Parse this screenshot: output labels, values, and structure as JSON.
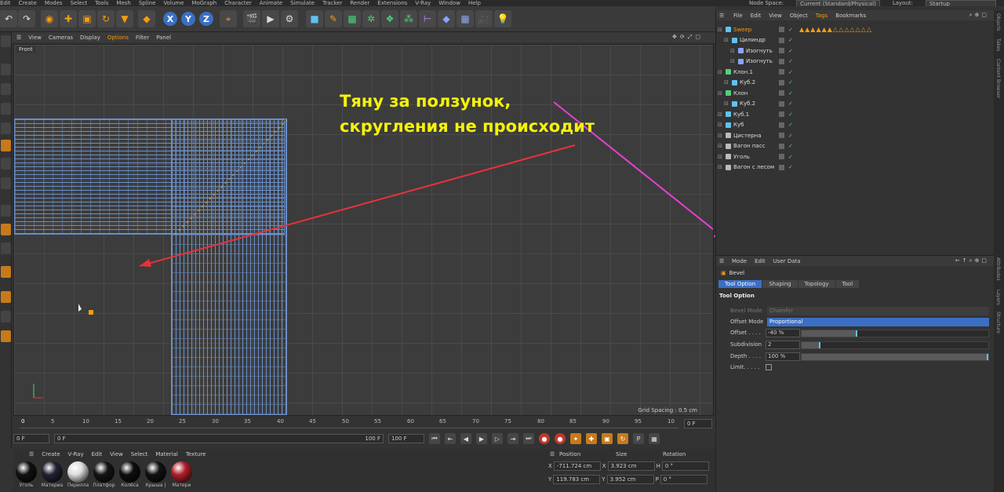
{
  "menubar": {
    "items": [
      "Edit",
      "Create",
      "Modes",
      "Select",
      "Tools",
      "Mesh",
      "Spline",
      "Volume",
      "MoGraph",
      "Character",
      "Animate",
      "Simulate",
      "Tracker",
      "Render",
      "Extensions",
      "V-Ray",
      "Window",
      "Help"
    ],
    "node_space_label": "Node Space:",
    "node_space_value": "Current (Standard/Physical)",
    "layout_label": "Layout:",
    "layout_value": "Startup"
  },
  "axis_buttons": [
    "X",
    "Y",
    "Z"
  ],
  "viewport": {
    "menu": [
      "View",
      "Cameras",
      "Display",
      "Options",
      "Filter",
      "Panel"
    ],
    "active_menu": "Options",
    "label": "Front",
    "grid_spacing": "Grid Spacing : 0.5 cm",
    "annotation_line1": "Тяну за ползунок,",
    "annotation_line2": "скругления не происходит",
    "arrow_colors": {
      "red": "#e8323a",
      "pink": "#e83fcf"
    }
  },
  "timeline": {
    "ticks": [
      "0",
      "5",
      "10",
      "15",
      "20",
      "25",
      "30",
      "35",
      "40",
      "45",
      "50",
      "55",
      "60",
      "65",
      "70",
      "75",
      "80",
      "85",
      "90",
      "95",
      "10"
    ],
    "current_frame": "0 F",
    "start_frame": "0 F",
    "range_field": "0 F",
    "end_frame": "100 F",
    "end_frame_2": "100 F",
    "frame_indicator": "0 F"
  },
  "materials": {
    "menu": [
      "Create",
      "V-Ray",
      "Edit",
      "View",
      "Select",
      "Material",
      "Texture"
    ],
    "items": [
      {
        "label": "Уголь",
        "color": "#111"
      },
      {
        "label": "Материа",
        "color": "#223"
      },
      {
        "label": "Перилла",
        "color": "#ddd"
      },
      {
        "label": "Платфор",
        "color": "#151515"
      },
      {
        "label": "Колёса",
        "color": "#0e0e0e"
      },
      {
        "label": "Крыша |",
        "color": "#121212"
      },
      {
        "label": "Матери",
        "color": "#b0202a"
      }
    ]
  },
  "coords": {
    "headers": [
      "Position",
      "Size",
      "Rotation"
    ],
    "rows": [
      {
        "axis": "X",
        "pos": "-711.724 cm",
        "size_axis": "X",
        "size": "3.923 cm",
        "rot_axis": "H",
        "rot": "0 °"
      },
      {
        "axis": "Y",
        "pos": "119.783 cm",
        "size_axis": "Y",
        "size": "3.952 cm",
        "rot_axis": "P",
        "rot": "0 °"
      }
    ]
  },
  "objects": {
    "menu": [
      "File",
      "Edit",
      "View",
      "Object",
      "Tags",
      "Bookmarks"
    ],
    "active_menu": "Tags",
    "items": [
      {
        "name": "Sweep",
        "indent": 0,
        "color": "#5ec3f2",
        "selected": true
      },
      {
        "name": "Цилиндр",
        "indent": 1,
        "color": "#5ec3f2",
        "selected": false
      },
      {
        "name": "Изогнуть",
        "indent": 2,
        "color": "#8aa4ff",
        "selected": false
      },
      {
        "name": "Изогнуть",
        "indent": 2,
        "color": "#8aa4ff",
        "selected": false
      },
      {
        "name": "Клон.1",
        "indent": 0,
        "color": "#4fd17c",
        "selected": false
      },
      {
        "name": "Куб.2",
        "indent": 1,
        "color": "#5ec3f2",
        "selected": false
      },
      {
        "name": "Клон",
        "indent": 0,
        "color": "#4fd17c",
        "selected": false
      },
      {
        "name": "Куб.2",
        "indent": 1,
        "color": "#5ec3f2",
        "selected": false
      },
      {
        "name": "Куб.1",
        "indent": 0,
        "color": "#5ec3f2",
        "selected": false
      },
      {
        "name": "Куб",
        "indent": 0,
        "color": "#5ec3f2",
        "selected": false
      },
      {
        "name": "Цистерна",
        "indent": 0,
        "color": "#bbb",
        "selected": false
      },
      {
        "name": "Вагон пасс",
        "indent": 0,
        "color": "#bbb",
        "selected": false
      },
      {
        "name": "Уголь",
        "indent": 0,
        "color": "#bbb",
        "selected": false
      },
      {
        "name": "Вагон с лесом",
        "indent": 0,
        "color": "#bbb",
        "selected": false
      }
    ],
    "sweep_tags": "▲▲▲▲▲▲△△△△△△△"
  },
  "attributes": {
    "menu": [
      "Mode",
      "Edit",
      "User Data"
    ],
    "title": "Bevel",
    "tabs": [
      "Tool Option",
      "Shaping",
      "Topology",
      "Tool"
    ],
    "active_tab": "Tool Option",
    "section": "Tool Option",
    "bevel_mode_label": "Bevel Mode",
    "bevel_mode_value": "Chamfer",
    "offset_mode_label": "Offset Mode",
    "offset_mode_value": "Proportional",
    "offset_label": "Offset . . . .",
    "offset_value": "-40 %",
    "offset_fraction": 0.3,
    "subdivision_label": "Subdivision",
    "subdivision_value": "2",
    "subdivision_fraction": 0.1,
    "depth_label": "Depth . . . .",
    "depth_value": "100 %",
    "depth_fraction": 1.0,
    "limit_label": "Limit. . . . ."
  },
  "side_tabs": [
    "Objects",
    "Takes",
    "Content Browser",
    "Attributes",
    "Layers",
    "Structure"
  ]
}
